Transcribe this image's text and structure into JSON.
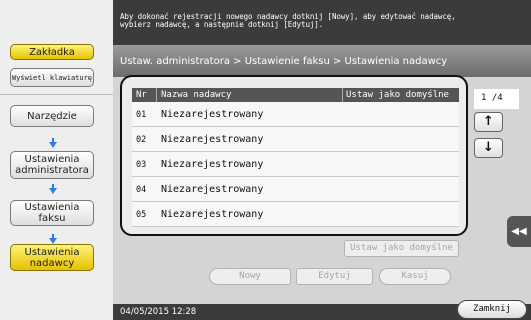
{
  "sidebar": {
    "bookmark": "Zakładka",
    "keyboard": "Wyświetl klawiaturę",
    "utility": "Narzędzie",
    "admin_settings": "Ustawienia administratora",
    "fax_settings": "Ustawienia faksu",
    "sender_settings": "Ustawienia nadawcy"
  },
  "message": {
    "line1": "Aby dokonać rejestracji nowego nadawcy dotknij [Nowy], aby edytować nadawcę,",
    "line2": "wybierz nadawcę, a następnie dotknij [Edytuj]."
  },
  "breadcrumb": "Ustaw. administratora > Ustawienie faksu > Ustawienia nadawcy",
  "table": {
    "headers": {
      "nr": "Nr",
      "name": "Nazwa nadawcy",
      "default": "Ustaw jako domyślne"
    },
    "rows": [
      {
        "nr": "01",
        "name": "Niezarejestrowany"
      },
      {
        "nr": "02",
        "name": "Niezarejestrowany"
      },
      {
        "nr": "03",
        "name": "Niezarejestrowany"
      },
      {
        "nr": "04",
        "name": "Niezarejestrowany"
      },
      {
        "nr": "05",
        "name": "Niezarejestrowany"
      }
    ]
  },
  "pager": {
    "page": "1 /4",
    "up": "↑",
    "down": "↓"
  },
  "side_tab": "◀◀",
  "buttons": {
    "set_default": "Ustaw jako domyślne",
    "new": "Nowy",
    "edit": "Edytuj",
    "delete": "Kasuj",
    "close": "Zamknij"
  },
  "status": {
    "datetime": "04/05/2015  12:28"
  },
  "colors": {
    "accent_yellow": "#f5d400",
    "arrow_blue": "#2f7fe0",
    "dark_bar": "#3b3b3b"
  }
}
